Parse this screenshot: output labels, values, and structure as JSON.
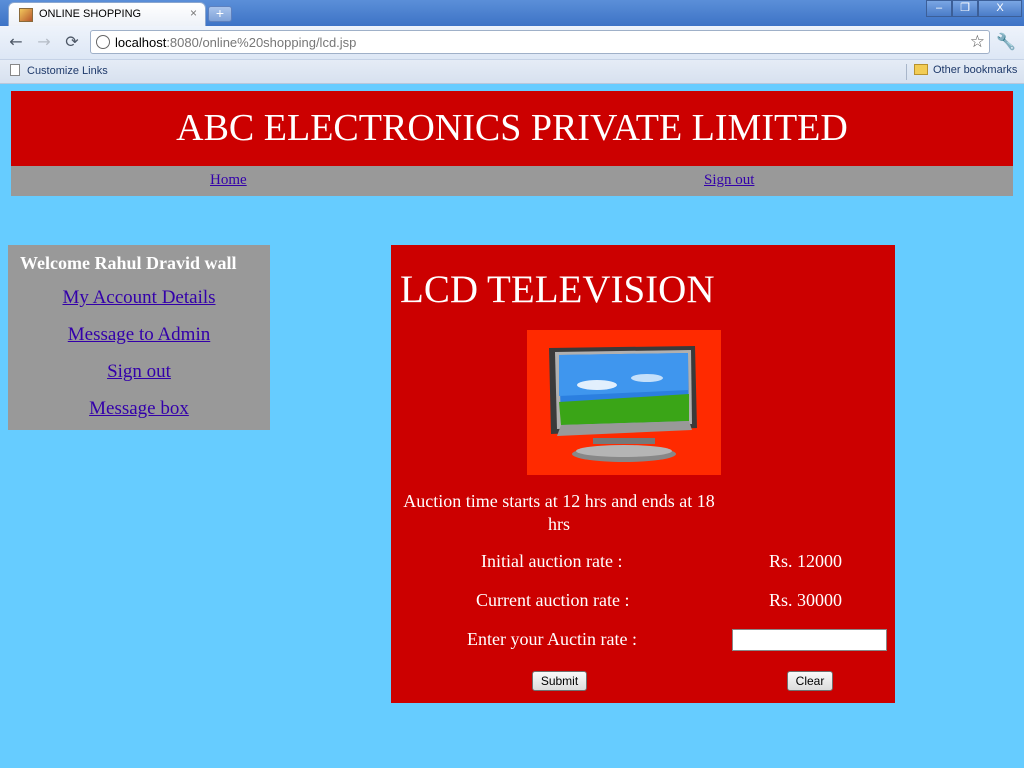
{
  "browser": {
    "tab_title": "ONLINE SHOPPING",
    "tab_close": "×",
    "new_tab": "+",
    "window_buttons": [
      "–",
      "❐",
      "X"
    ],
    "back": "←",
    "forward": "→",
    "reload": "⟳",
    "url_host": "localhost",
    "url_rest": ":8080/online%20shopping/lcd.jsp",
    "star": "☆",
    "wrench": "🔧",
    "bookmarks": {
      "left_label": "Customize Links",
      "right_label": "Other bookmarks"
    }
  },
  "header": {
    "title": "ABC ELECTRONICS PRIVATE LIMITED",
    "nav": {
      "home": "Home",
      "signout": "Sign out"
    }
  },
  "sidebar": {
    "welcome": "Welcome Rahul Dravid wall",
    "links": [
      "My Account Details",
      "Message to Admin",
      "Sign out",
      "Message box"
    ]
  },
  "product": {
    "title": "LCD TELEVISION",
    "auction_time": "Auction time starts at 12 hrs and ends at 18 hrs",
    "initial_label": "Initial auction rate :",
    "initial_value": "Rs. 12000",
    "current_label": "Current auction rate :",
    "current_value": "Rs. 30000",
    "enter_label": "Enter your Auctin rate :",
    "input_value": "",
    "submit_label": "Submit",
    "clear_label": "Clear"
  },
  "colors": {
    "page_bg": "#66ccff",
    "brand_red": "#cc0000",
    "nav_gray": "#999999",
    "link": "#3300aa"
  }
}
